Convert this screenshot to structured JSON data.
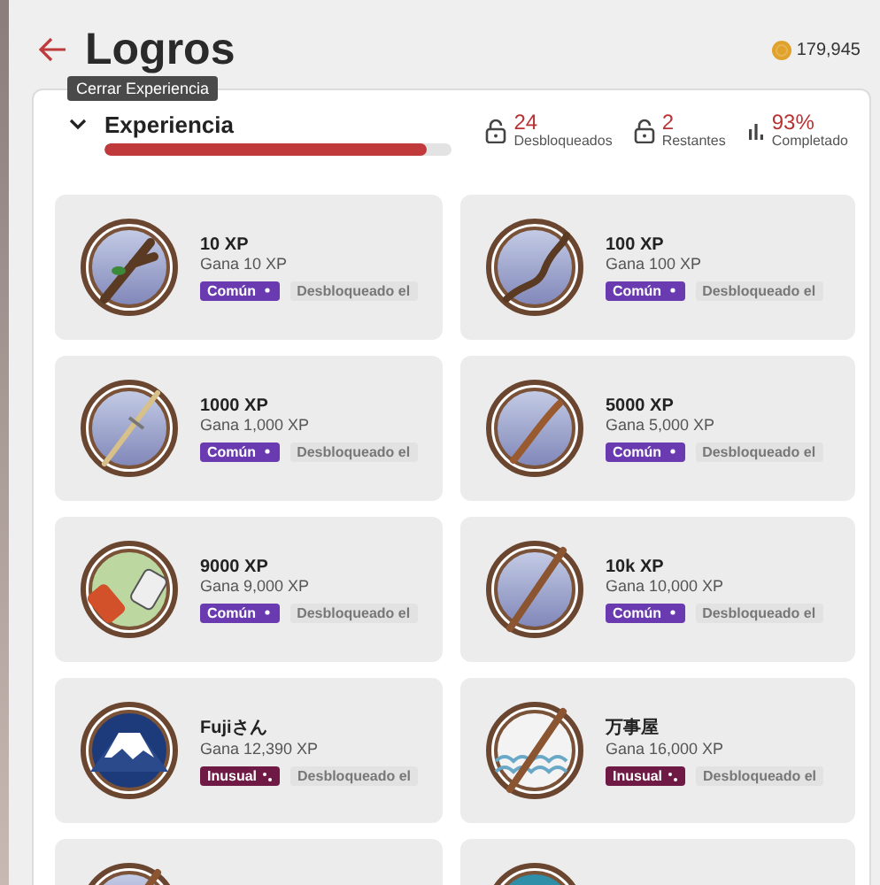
{
  "header": {
    "title": "Logros",
    "tooltip": "Cerrar Experiencia",
    "coins": "179,945"
  },
  "section": {
    "title": "Experiencia",
    "expanded": true,
    "level": 0.93,
    "stats": [
      {
        "kind": "lock",
        "value": "24",
        "label": "Desbloqueados"
      },
      {
        "kind": "lock",
        "value": "2",
        "label": "Restantes"
      },
      {
        "kind": "chart",
        "value": "93%",
        "label": "Completado"
      }
    ]
  },
  "achievements": [
    {
      "kind": "twig",
      "title": "10 XP",
      "subtitle": "Gana 10 XP",
      "rarity": {
        "kind": "common",
        "label": "Común",
        "color": "#6a3ab0"
      },
      "status": "Desbloqueado el"
    },
    {
      "kind": "branch",
      "title": "100 XP",
      "subtitle": "Gana 100 XP",
      "rarity": {
        "kind": "common",
        "label": "Común",
        "color": "#6a3ab0"
      },
      "status": "Desbloqueado el"
    },
    {
      "kind": "sword",
      "title": "1000 XP",
      "subtitle": "Gana 1,000 XP",
      "rarity": {
        "kind": "common",
        "label": "Común",
        "color": "#6a3ab0"
      },
      "status": "Desbloqueado el"
    },
    {
      "kind": "stick",
      "title": "5000 XP",
      "subtitle": "Gana 5,000 XP",
      "rarity": {
        "kind": "common",
        "label": "Común",
        "color": "#6a3ab0"
      },
      "status": "Desbloqueado el"
    },
    {
      "kind": "bottles",
      "title": "9000 XP",
      "subtitle": "Gana 9,000 XP",
      "rarity": {
        "kind": "common",
        "label": "Común",
        "color": "#6a3ab0"
      },
      "status": "Desbloqueado el"
    },
    {
      "kind": "pole",
      "title": "10k XP",
      "subtitle": "Gana 10,000 XP",
      "rarity": {
        "kind": "common",
        "label": "Común",
        "color": "#6a3ab0"
      },
      "status": "Desbloqueado el"
    },
    {
      "kind": "fuji",
      "title": "Fujiさん",
      "subtitle": "Gana 12,390 XP",
      "rarity": {
        "kind": "uncommon",
        "label": "Inusual",
        "color": "#6e1a44"
      },
      "status": "Desbloqueado el"
    },
    {
      "kind": "waves",
      "title": "万事屋",
      "subtitle": "Gana 16,000 XP",
      "rarity": {
        "kind": "uncommon",
        "label": "Inusual",
        "color": "#6e1a44"
      },
      "status": "Desbloqueado el"
    },
    {
      "kind": "partial_stick"
    },
    {
      "kind": "partial_teal"
    }
  ]
}
